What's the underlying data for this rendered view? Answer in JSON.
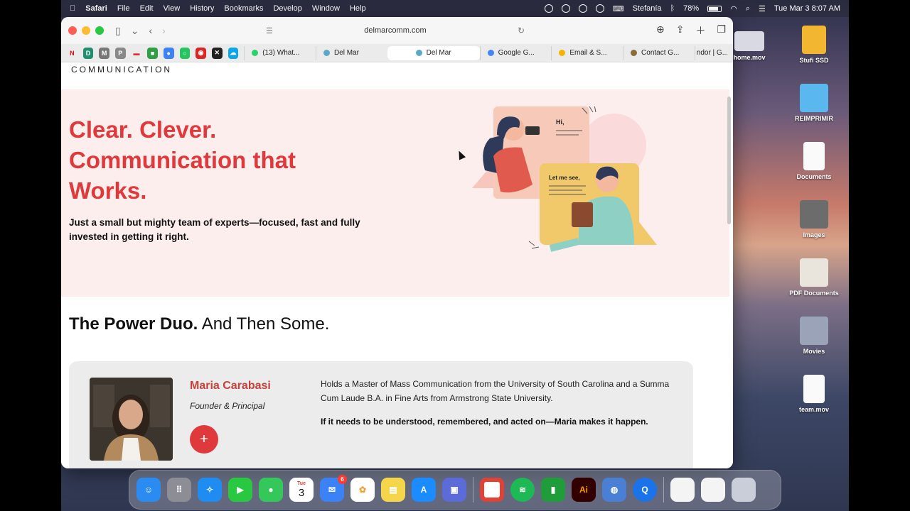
{
  "menubar": {
    "app": "Safari",
    "items": [
      "File",
      "Edit",
      "View",
      "History",
      "Bookmarks",
      "Develop",
      "Window",
      "Help"
    ],
    "user": "Stefanía",
    "battery": "78%",
    "datetime": "Tue Mar 3  8:07 AM"
  },
  "browser": {
    "url": "delmarcomm.com",
    "favorites": [
      {
        "icon": "netflix-icon",
        "glyph": "N",
        "color": "#e50914"
      },
      {
        "icon": "site-icon",
        "glyph": "D",
        "color": "#1f8f6f"
      },
      {
        "icon": "m-icon",
        "glyph": "M",
        "color": "#777777"
      },
      {
        "icon": "p-icon",
        "glyph": "P",
        "color": "#888888"
      },
      {
        "icon": "app-icon",
        "glyph": "▬",
        "color": "#e03030"
      },
      {
        "icon": "green-icon",
        "glyph": "■",
        "color": "#2ea043"
      },
      {
        "icon": "circle-icon",
        "glyph": "●",
        "color": "#3b82f6"
      },
      {
        "icon": "ring-icon",
        "glyph": "○",
        "color": "#22c55e"
      },
      {
        "icon": "red-icon",
        "glyph": "◉",
        "color": "#dc2626"
      },
      {
        "icon": "x-icon",
        "glyph": "✕",
        "color": "#222222"
      },
      {
        "icon": "cloud-icon",
        "glyph": "☁",
        "color": "#0ea5e9"
      }
    ],
    "tabs": [
      {
        "label": "(13) What...",
        "color": "#25d366",
        "active": false
      },
      {
        "label": "Del Mar",
        "color": "#5aa9c8",
        "active": false
      },
      {
        "label": "Del Mar",
        "color": "#5aa9c8",
        "active": true
      },
      {
        "label": "Google G...",
        "color": "#4285f4",
        "active": false
      },
      {
        "label": "Email & S...",
        "color": "#f5b400",
        "active": false
      },
      {
        "label": "Contact G...",
        "color": "#8a6d3b",
        "active": false
      },
      {
        "label": "ndor | G...",
        "color": "#999999",
        "active": false
      }
    ]
  },
  "page": {
    "logo_text": "COMMUNICATION",
    "hero": {
      "title": "Clear. Clever. Communication that Works.",
      "subtitle": "Just a small but mighty team of experts—focused, fast and fully invested in getting it right."
    },
    "illustration": {
      "bubble_1": "Hi,",
      "bubble_2": "Let me see,"
    },
    "section": {
      "title_bold": "The Power Duo.",
      "title_rest": " And Then Some."
    },
    "card": {
      "name": "Maria Carabasi",
      "role": "Founder & Principal",
      "plus": "+",
      "bio": "Holds a Master of Mass Communication from the University of South Carolina and a Summa Cum Laude B.A. in Fine Arts from Armstrong State University.",
      "quote": "If it needs to be understood, remembered, and acted on—Maria makes it happen."
    }
  },
  "desktop": [
    {
      "label": "home.mov",
      "kind": "video"
    },
    {
      "label": "Stufi SSD",
      "kind": "drive"
    },
    {
      "label": "REIMPRIMIR",
      "kind": "folder"
    },
    {
      "label": "Documents",
      "kind": "document"
    },
    {
      "label": "Images",
      "kind": "images"
    },
    {
      "label": "PDF Documents",
      "kind": "document"
    },
    {
      "label": "Movies",
      "kind": "movies"
    },
    {
      "label": "team.mov",
      "kind": "document"
    }
  ],
  "dock": {
    "calendar_day": "Tue",
    "calendar_date": "3",
    "mail_badge": "6",
    "apps": [
      {
        "name": "finder",
        "color": "#2a8cf0"
      },
      {
        "name": "launchpad",
        "color": "#8d8d95"
      },
      {
        "name": "safari",
        "color": "#1e8cf0"
      },
      {
        "name": "facetime",
        "color": "#28c840"
      },
      {
        "name": "messages",
        "color": "#34c759"
      },
      {
        "name": "calendar",
        "color": "#ffffff"
      },
      {
        "name": "mail",
        "color": "#3b82f6"
      },
      {
        "name": "photos",
        "color": "#f0a030"
      },
      {
        "name": "notes",
        "color": "#f5d54a"
      },
      {
        "name": "app-store",
        "color": "#1a8cff"
      },
      {
        "name": "preview",
        "color": "#5b6bd8"
      },
      {
        "name": "chrome",
        "color": "#ffffff"
      },
      {
        "name": "spotify",
        "color": "#1db954"
      },
      {
        "name": "numbers",
        "color": "#1f9d3a"
      },
      {
        "name": "illustrator",
        "color": "#330000"
      },
      {
        "name": "utility",
        "color": "#4a7fd6"
      },
      {
        "name": "quicktime",
        "color": "#1a73e8"
      }
    ],
    "illustrator_label": "Ai"
  }
}
